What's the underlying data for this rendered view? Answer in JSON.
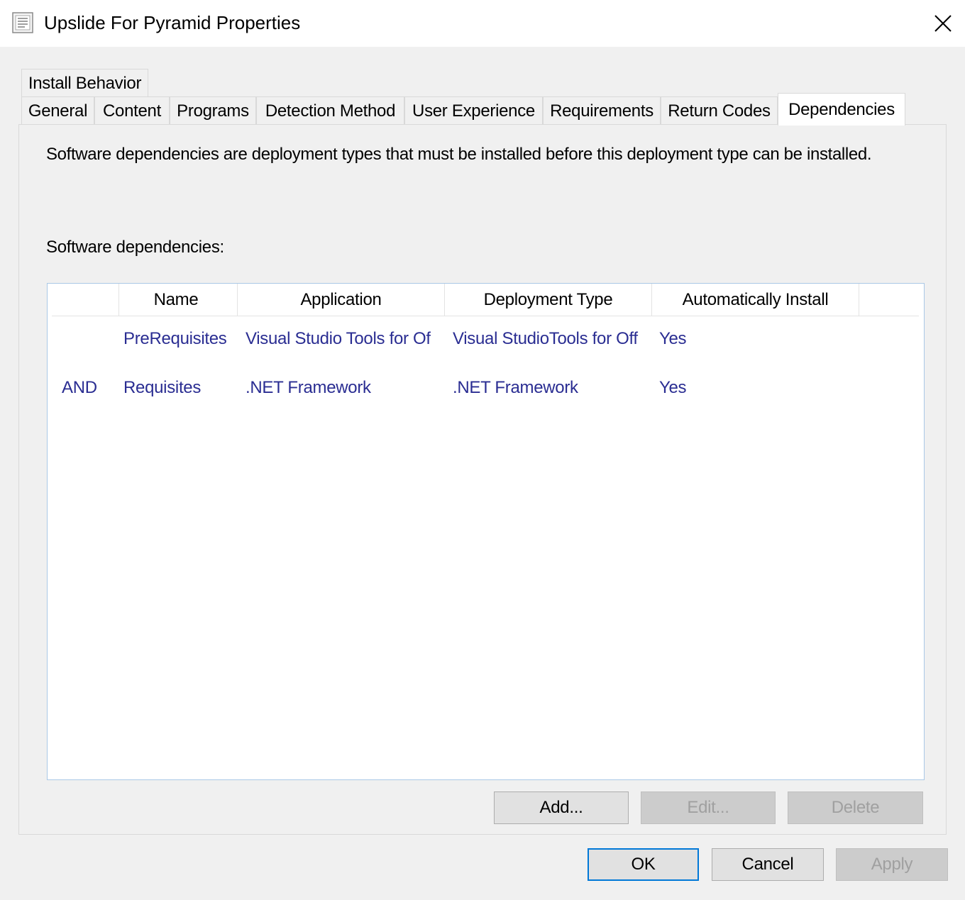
{
  "window": {
    "title": "Upslide For Pyramid Properties",
    "icon": "properties-sheet-icon",
    "close_icon": "close-icon"
  },
  "tabs": {
    "row_back": [
      {
        "label": "Install Behavior"
      }
    ],
    "row_front": [
      {
        "label": "General"
      },
      {
        "label": "Content"
      },
      {
        "label": "Programs"
      },
      {
        "label": "Detection Method"
      },
      {
        "label": "User Experience"
      },
      {
        "label": "Requirements"
      },
      {
        "label": "Return Codes"
      },
      {
        "label": "Dependencies",
        "active": true
      }
    ]
  },
  "panel": {
    "description": "Software dependencies are deployment types that must be installed before this deployment type can be installed.",
    "list_label": "Software dependencies:"
  },
  "list": {
    "columns": [
      "",
      "Name",
      "Application",
      "Deployment Type",
      "Automatically Install"
    ],
    "rows": [
      {
        "op": "",
        "name": "PreRequisites",
        "application": "Visual Studio Tools for Of",
        "deployment_type": "Visual StudioTools for Off",
        "auto_install": "Yes"
      },
      {
        "op": "AND",
        "name": "Requisites",
        "application": ".NET Framework",
        "deployment_type": ".NET Framework",
        "auto_install": "Yes"
      }
    ]
  },
  "list_buttons": {
    "add": "Add...",
    "edit": "Edit...",
    "delete": "Delete"
  },
  "dialog_buttons": {
    "ok": "OK",
    "cancel": "Cancel",
    "apply": "Apply"
  },
  "colors": {
    "list_text": "#2a2d92",
    "accent": "#0078d7"
  }
}
